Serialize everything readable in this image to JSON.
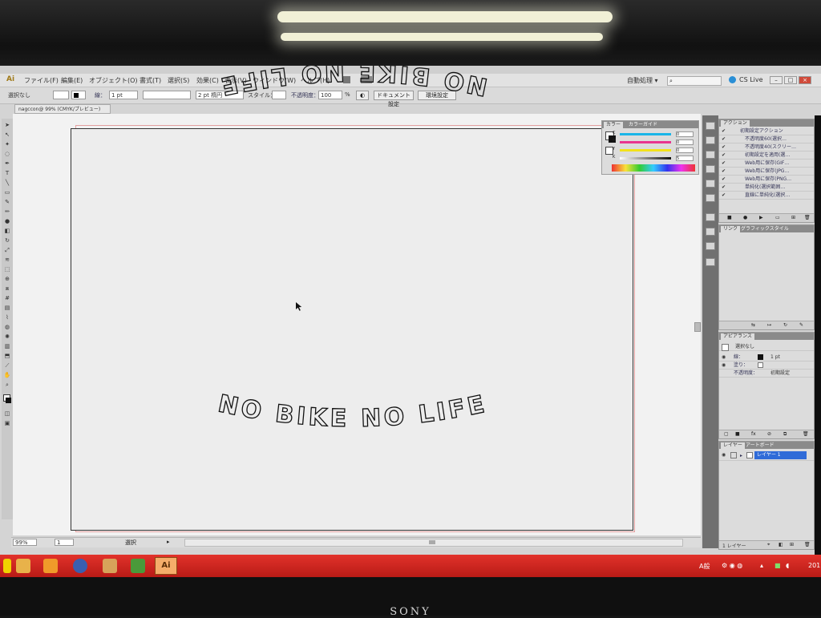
{
  "monitor": {
    "brand": "SONY"
  },
  "menubar": {
    "logo": "Ai",
    "items": [
      "ファイル(F)",
      "編集(E)",
      "オブジェクト(O)",
      "書式(T)",
      "選択(S)",
      "効果(C)",
      "表示(V)",
      "ウィンドウ(W)",
      "ヘルプ(H)"
    ],
    "workspace": "自動処理 ▾",
    "cs_live": "CS Live"
  },
  "options_bar": {
    "selection_label": "選択なし",
    "stroke_label": "線：",
    "stroke_weight": "1 pt",
    "brush_label": "2 pt 楕円",
    "style_label": "スタイル：",
    "opacity_label": "不透明度：",
    "opacity_value": "100",
    "opacity_unit": "%",
    "doc_setup_button": "ドキュメント設定",
    "prefs_button": "環境設定"
  },
  "document": {
    "tab_title": "nagccon@ 99% (CMYK/プレビュー)",
    "zoom": "99%",
    "page": "1",
    "status": "選択",
    "arc_top_text": "NO BIKE NO LIFE",
    "arc_bottom_text": "NO BIKE NO LIFE"
  },
  "color_panel": {
    "tabs": [
      "カラー",
      "カラーガイド"
    ],
    "channels": [
      {
        "name": "C",
        "value": "0",
        "color": "#19b5e8"
      },
      {
        "name": "M",
        "value": "0",
        "color": "#e8358e"
      },
      {
        "name": "Y",
        "value": "0",
        "color": "#f2e21a"
      },
      {
        "name": "K",
        "value": "5",
        "color": "#333333"
      }
    ]
  },
  "actions_panel": {
    "tabs": [
      "アクション"
    ],
    "items": [
      "初期設定アクション",
      "不透明度60(選択…",
      "不透明度40(スクリー…",
      "初期設定を適用(選…",
      "Web用に保存(GIF…",
      "Web用に保存(JPG…",
      "Web用に保存(PNG…",
      "単純化(選択範囲…",
      "直線に単純化(選択…"
    ]
  },
  "links_panel": {
    "tabs": [
      "リンク",
      "グラフィックスタイル"
    ]
  },
  "appearance_panel": {
    "tabs": [
      "アピアランス"
    ],
    "title": "選択なし",
    "stroke_label": "線：",
    "stroke_value": "1 pt",
    "fill_label": "塗り：",
    "opacity_label": "不透明度：",
    "opacity_value": "初期設定"
  },
  "layers_panel": {
    "tabs": [
      "レイヤー",
      "アートボード"
    ],
    "layer_name": "レイヤー 1",
    "footer": "1 レイヤー"
  },
  "taskbar": {
    "active_app": "Ai",
    "ime": "A般",
    "tray_time": "201"
  },
  "colors": {
    "taskbar": "#c8211b",
    "layer_selected": "#2f6bd8",
    "bleed_guide": "#e3a0a0"
  }
}
